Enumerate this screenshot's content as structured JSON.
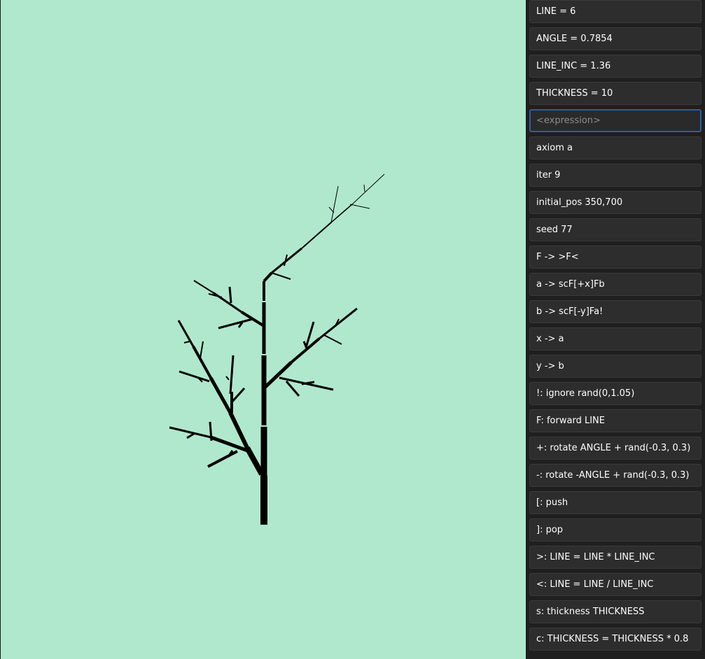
{
  "canvas": {
    "background": "#b0e8cd",
    "stroke_color": "#000000"
  },
  "panel": {
    "items": [
      {
        "label": "LINE = 6"
      },
      {
        "label": "ANGLE = 0.7854"
      },
      {
        "label": "LINE_INC = 1.36"
      },
      {
        "label": "THICKNESS = 10"
      },
      {
        "label": "",
        "placeholder": "<expression>",
        "active": true
      },
      {
        "label": "axiom a"
      },
      {
        "label": "iter 9"
      },
      {
        "label": "initial_pos 350,700"
      },
      {
        "label": "seed 77"
      },
      {
        "label": "F -> >F<"
      },
      {
        "label": "a -> scF[+x]Fb"
      },
      {
        "label": "b -> scF[-y]Fa!"
      },
      {
        "label": "x -> a"
      },
      {
        "label": "y -> b"
      },
      {
        "label": "!: ignore rand(0,1.05)"
      },
      {
        "label": "F: forward LINE"
      },
      {
        "label": "+: rotate ANGLE + rand(-0.3, 0.3)"
      },
      {
        "label": "-: rotate -ANGLE + rand(-0.3, 0.3)"
      },
      {
        "label": "[: push"
      },
      {
        "label": "]: pop"
      },
      {
        "label": ">: LINE = LINE * LINE_INC"
      },
      {
        "label": "<: LINE = LINE / LINE_INC"
      },
      {
        "label": "s: thickness THICKNESS"
      },
      {
        "label": "c: THICKNESS = THICKNESS * 0.8"
      }
    ]
  },
  "colors": {
    "panel_bg": "#1f1f1f",
    "row_bg": "#2d2d2d",
    "focus_border": "#2a5da8",
    "text": "#ffffff",
    "placeholder": "#8c8c8c"
  }
}
